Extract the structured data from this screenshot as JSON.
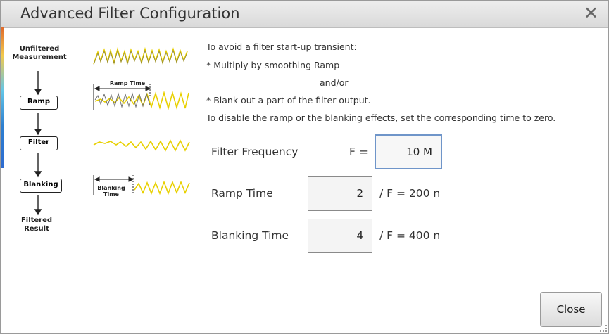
{
  "window": {
    "title": "Advanced Filter Configuration"
  },
  "diagram": {
    "unfiltered": "Unfiltered\nMeasurement",
    "ramp": "Ramp",
    "filter": "Filter",
    "blanking": "Blanking",
    "filtered": "Filtered\nResult",
    "ramp_time_label": "Ramp Time",
    "blanking_time_label": "Blanking\nTime"
  },
  "info": {
    "line1": "To avoid a filter start-up transient:",
    "line2": "* Multiply by smoothing Ramp",
    "line3": "and/or",
    "line4": "* Blank out a part of the filter output.",
    "line5": "To disable the ramp or the blanking effects, set the corresponding time to zero."
  },
  "fields": {
    "filter_frequency": {
      "label": "Filter Frequency",
      "prefix": "F =",
      "value": "10 M"
    },
    "ramp_time": {
      "label": "Ramp Time",
      "value": "2",
      "suffix": "/ F = 200 n"
    },
    "blanking_time": {
      "label": "Blanking Time",
      "value": "4",
      "suffix": "/ F = 400 n"
    }
  },
  "buttons": {
    "close": "Close"
  },
  "colors": {
    "waveform": "#e8d000",
    "focus_border": "#6f95c9"
  },
  "icons": [
    "close-icon",
    "resize-grip-icon"
  ]
}
